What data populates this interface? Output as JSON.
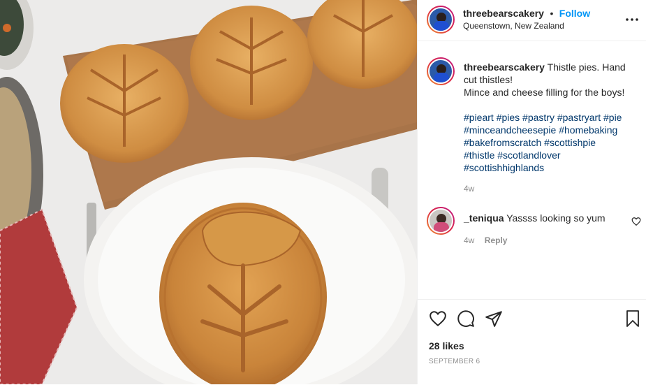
{
  "photo": {
    "description_icon": "food-photo"
  },
  "header": {
    "username": "threebearscakery",
    "dot": "•",
    "follow_label": "Follow",
    "location": "Queenstown, New Zealand",
    "more_icon": "more-horizontal-icon"
  },
  "caption": {
    "username": "threebearscakery",
    "line1": " Thistle pies. Hand cut thistles!",
    "line2": "Mince and cheese filling for the boys!",
    "hashtags": [
      "#pieart #pies #pastry #pastryart #pie",
      "#minceandcheesepie #homebaking",
      "#bakefromscratch #scottishpie",
      "#thistle #scotlandlover",
      "#scottishhighlands"
    ],
    "time": "4w"
  },
  "comments": [
    {
      "username": "_teniqua",
      "text": " Yassss looking so yum",
      "time": "4w",
      "reply_label": "Reply"
    }
  ],
  "actions": {
    "likes": "28 likes",
    "date": "SEPTEMBER 6"
  },
  "colors": {
    "accent": "#0095f6",
    "hashtag": "#00376b",
    "muted": "#8e8e8e"
  }
}
